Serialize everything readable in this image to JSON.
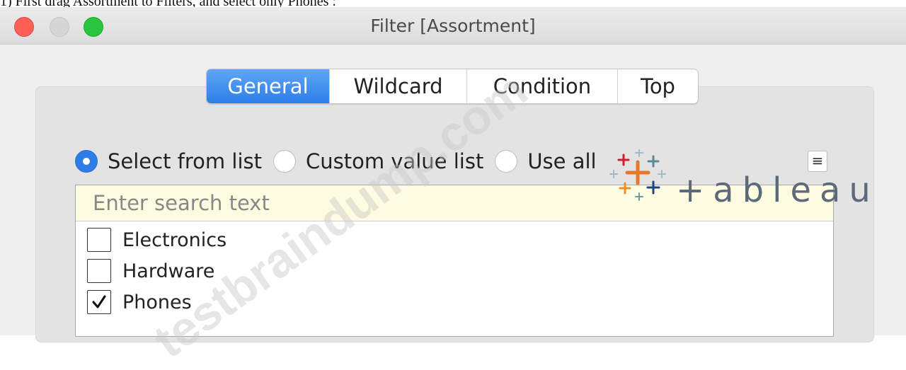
{
  "instruction": "1) First drag Assortment to Filters, and select only Phones :",
  "window": {
    "title": "Filter [Assortment]"
  },
  "tabs": [
    {
      "label": "General",
      "active": true
    },
    {
      "label": "Wildcard",
      "active": false
    },
    {
      "label": "Condition",
      "active": false
    },
    {
      "label": "Top",
      "active": false
    }
  ],
  "options": {
    "select_from_list": "Select from list",
    "custom_value_list": "Custom value list",
    "use_all": "Use all",
    "selected": "select_from_list"
  },
  "search": {
    "placeholder": "Enter search text",
    "value": ""
  },
  "items": [
    {
      "label": "Electronics",
      "checked": false
    },
    {
      "label": "Hardware",
      "checked": false
    },
    {
      "label": "Phones",
      "checked": true
    }
  ],
  "logo": {
    "text": "+ableau"
  },
  "watermark": "testbraindump.com",
  "colors": {
    "accent": "#2e7de6",
    "search_bg": "#fdfbe0"
  }
}
